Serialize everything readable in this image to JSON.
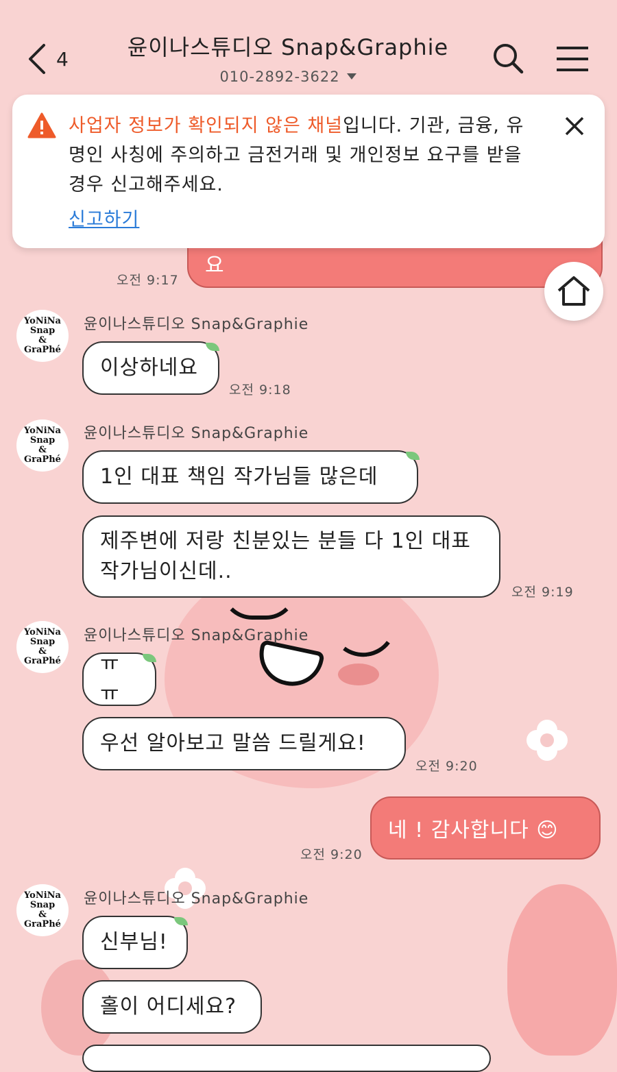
{
  "header": {
    "back_count": "4",
    "title": "윤이나스튜디오 Snap&Graphie",
    "phone": "010-2892-3622"
  },
  "warning": {
    "highlight": "사업자 정보가 확인되지 않은 채널",
    "text": "입니다. 기관, 금융, 유명인 사칭에 주의하고 금전거래 및 개인정보 요구를 받을 경우 신고해주세요.",
    "report_link": "신고하기"
  },
  "messages": {
    "m0": {
      "text": "요",
      "time": "오전 9:17"
    },
    "g1": {
      "sender": "윤이나스튜디오 Snap&Graphie",
      "items": [
        "이상하네요"
      ],
      "time": "오전 9:18"
    },
    "g2": {
      "sender": "윤이나스튜디오 Snap&Graphie",
      "items": [
        "1인 대표 책임 작가님들 많은데",
        "제주변에 저랑 친분있는 분들 다 1인 대표작가님이신데.."
      ],
      "time": "오전 9:19"
    },
    "g3": {
      "sender": "윤이나스튜디오 Snap&Graphie",
      "items": [
        "ㅠㅠ",
        "우선 알아보고 말씀 드릴게요!"
      ],
      "time": "오전 9:20"
    },
    "m_out": {
      "text": "네 ! 감사합니다 😊",
      "time": "오전 9:20"
    },
    "g4": {
      "sender": "윤이나스튜디오 Snap&Graphie",
      "items": [
        "신부님!",
        "홀이 어디세요?"
      ]
    }
  },
  "avatar_logo": {
    "l1": "YoNiNa",
    "l2": "Snap",
    "l3": "&",
    "l4": "GraPhé"
  },
  "colors": {
    "background": "#f9d3d2",
    "outgoing_bubble": "#f37b78",
    "warning_highlight": "#ee5b2a",
    "link": "#2a7bd8"
  },
  "icons": [
    "back-icon",
    "search-icon",
    "menu-icon",
    "warning-icon",
    "close-icon",
    "home-icon",
    "chevron-down-icon"
  ]
}
